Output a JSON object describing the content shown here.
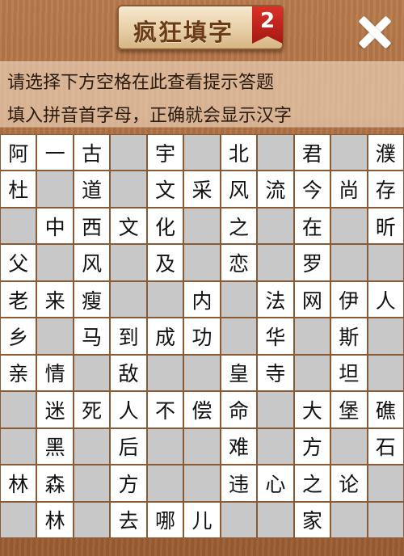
{
  "header": {
    "title": "疯狂填字",
    "level": "2",
    "close_icon": "close-icon"
  },
  "hints": {
    "line1": "请选择下方空格在此查看提示答题",
    "line2": "填入拼音首字母，正确就会显示汉字"
  },
  "colors": {
    "blocked_cell": "#c8c8c8",
    "open_cell": "#ffffff",
    "grid_line": "#8a5a35",
    "badge_red": "#c62a22"
  },
  "grid": {
    "rows": [
      [
        "阿",
        "一",
        "古",
        "#",
        "宇",
        "#",
        "北",
        "#",
        "君",
        "#",
        "濮"
      ],
      [
        "杜",
        "#",
        "道",
        "#",
        "文",
        "采",
        "风",
        "流",
        "今",
        "尚",
        "存"
      ],
      [
        "#",
        "中",
        "西",
        "文",
        "化",
        "#",
        "之",
        "#",
        "在",
        "#",
        "昕"
      ],
      [
        "父",
        "#",
        "风",
        "#",
        "及",
        "#",
        "恋",
        "#",
        "罗",
        "#",
        "#"
      ],
      [
        "老",
        "来",
        "瘦",
        "#",
        "#",
        "内",
        "#",
        "法",
        "网",
        "伊",
        "人"
      ],
      [
        "乡",
        "#",
        "马",
        "到",
        "成",
        "功",
        "#",
        "华",
        "#",
        "斯",
        "#"
      ],
      [
        "亲",
        "情",
        "#",
        "敌",
        "#",
        "#",
        "皇",
        "寺",
        "#",
        "坦",
        "#"
      ],
      [
        "#",
        "迷",
        "死",
        "人",
        "不",
        "偿",
        "命",
        "#",
        "大",
        "堡",
        "礁"
      ],
      [
        "#",
        "黑",
        "#",
        "后",
        "#",
        "#",
        "难",
        "#",
        "方",
        "#",
        "石"
      ],
      [
        "林",
        "森",
        "#",
        "方",
        "#",
        "#",
        "违",
        "心",
        "之",
        "论",
        "#"
      ],
      [
        "#",
        "林",
        "#",
        "去",
        "哪",
        "儿",
        "#",
        "#",
        "家",
        "#",
        "#"
      ]
    ]
  }
}
